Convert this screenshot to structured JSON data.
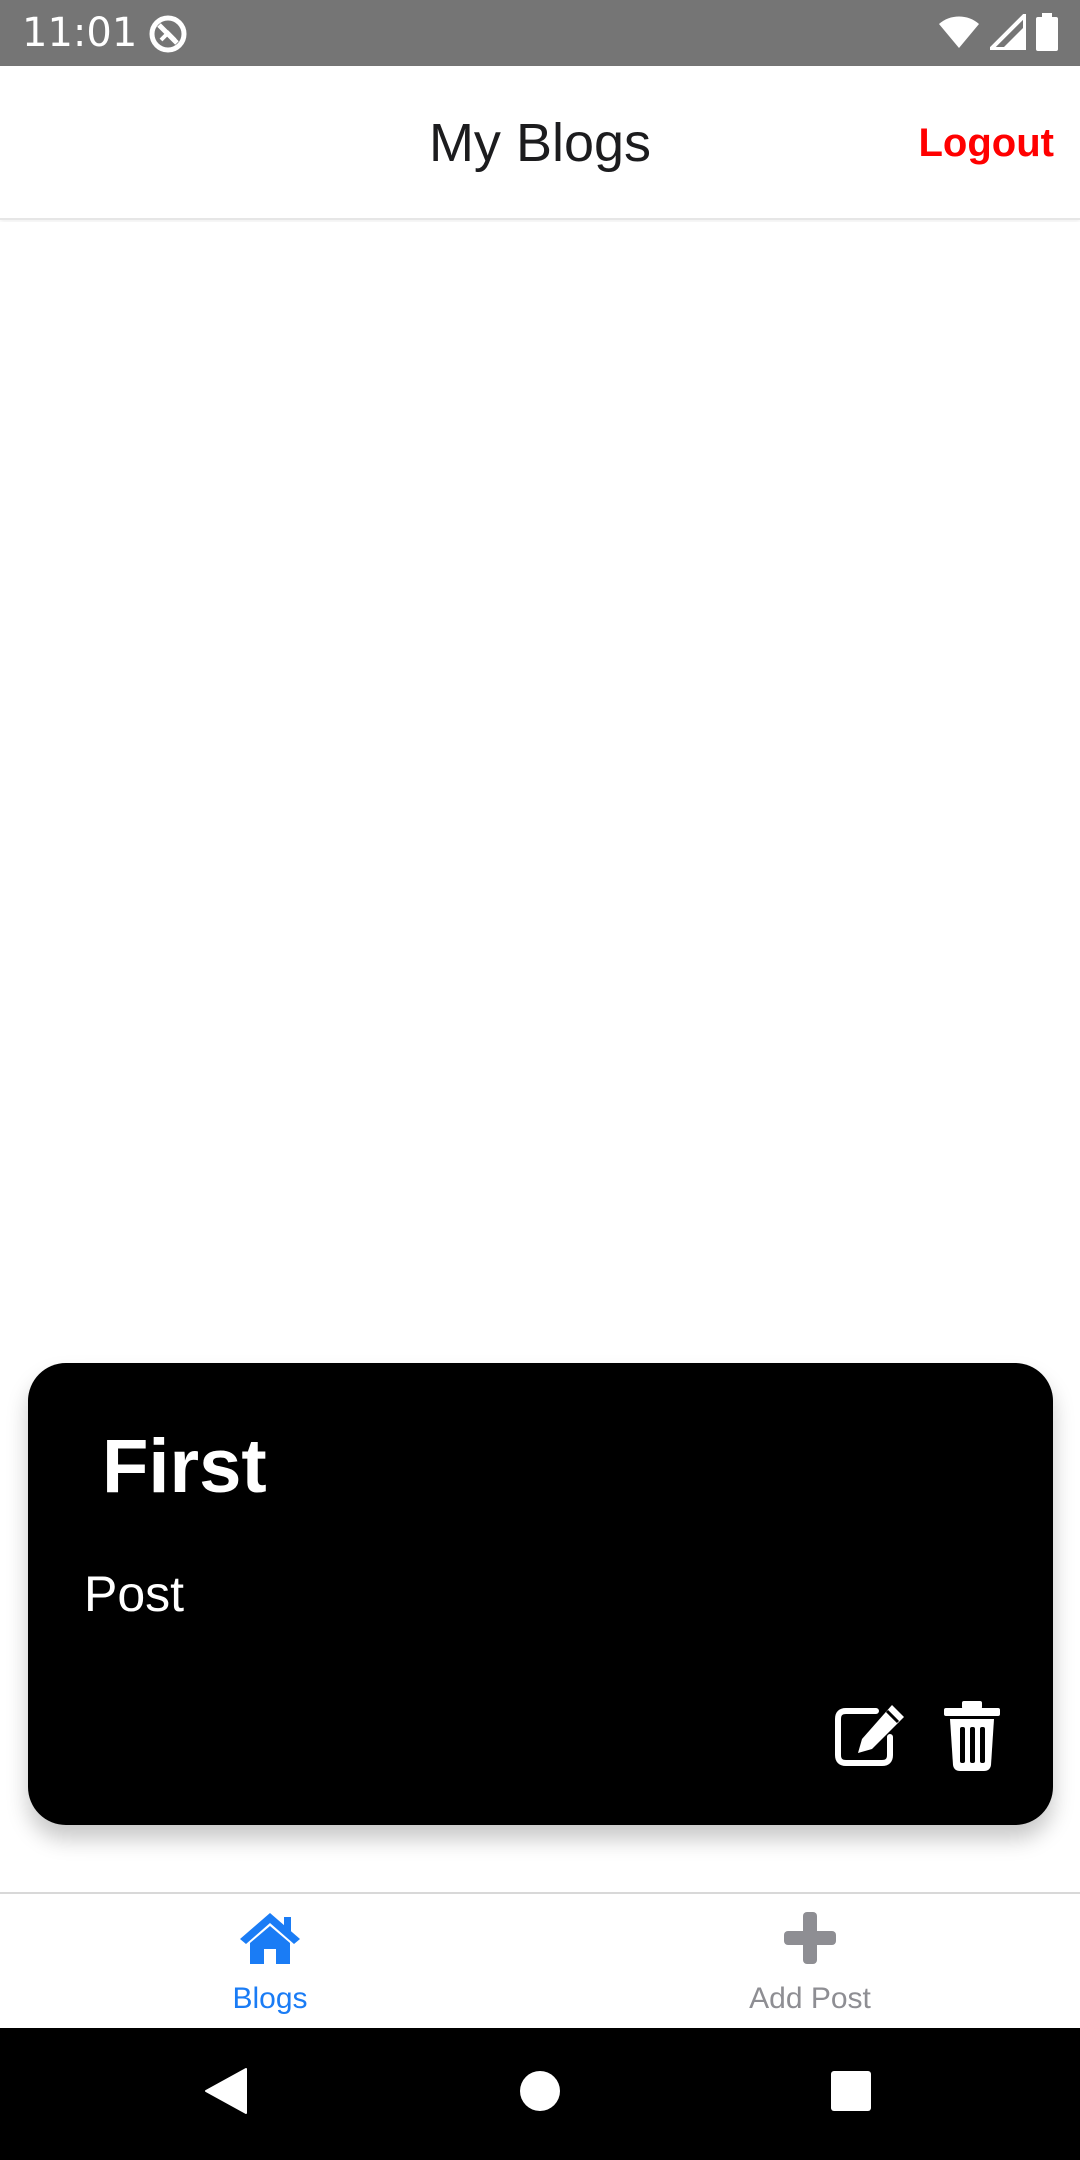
{
  "status_bar": {
    "time": "11:01",
    "icons": [
      "app-notification-icon",
      "wifi-icon",
      "cellular-signal-icon",
      "battery-icon"
    ]
  },
  "header": {
    "title": "My Blogs",
    "logout_label": "Logout",
    "logout_color": "#ff0000"
  },
  "posts": [
    {
      "title": "First",
      "body": "Post",
      "actions": [
        "edit-icon",
        "trash-icon"
      ]
    }
  ],
  "tab_bar": {
    "tabs": [
      {
        "label": "Blogs",
        "icon": "home-icon",
        "active": true
      },
      {
        "label": "Add Post",
        "icon": "plus-icon",
        "active": false
      }
    ],
    "active_color": "#1a7cf5",
    "inactive_color": "#8e8e93"
  },
  "nav_bar": {
    "buttons": [
      "back-icon",
      "home-circle-icon",
      "recents-square-icon"
    ]
  }
}
